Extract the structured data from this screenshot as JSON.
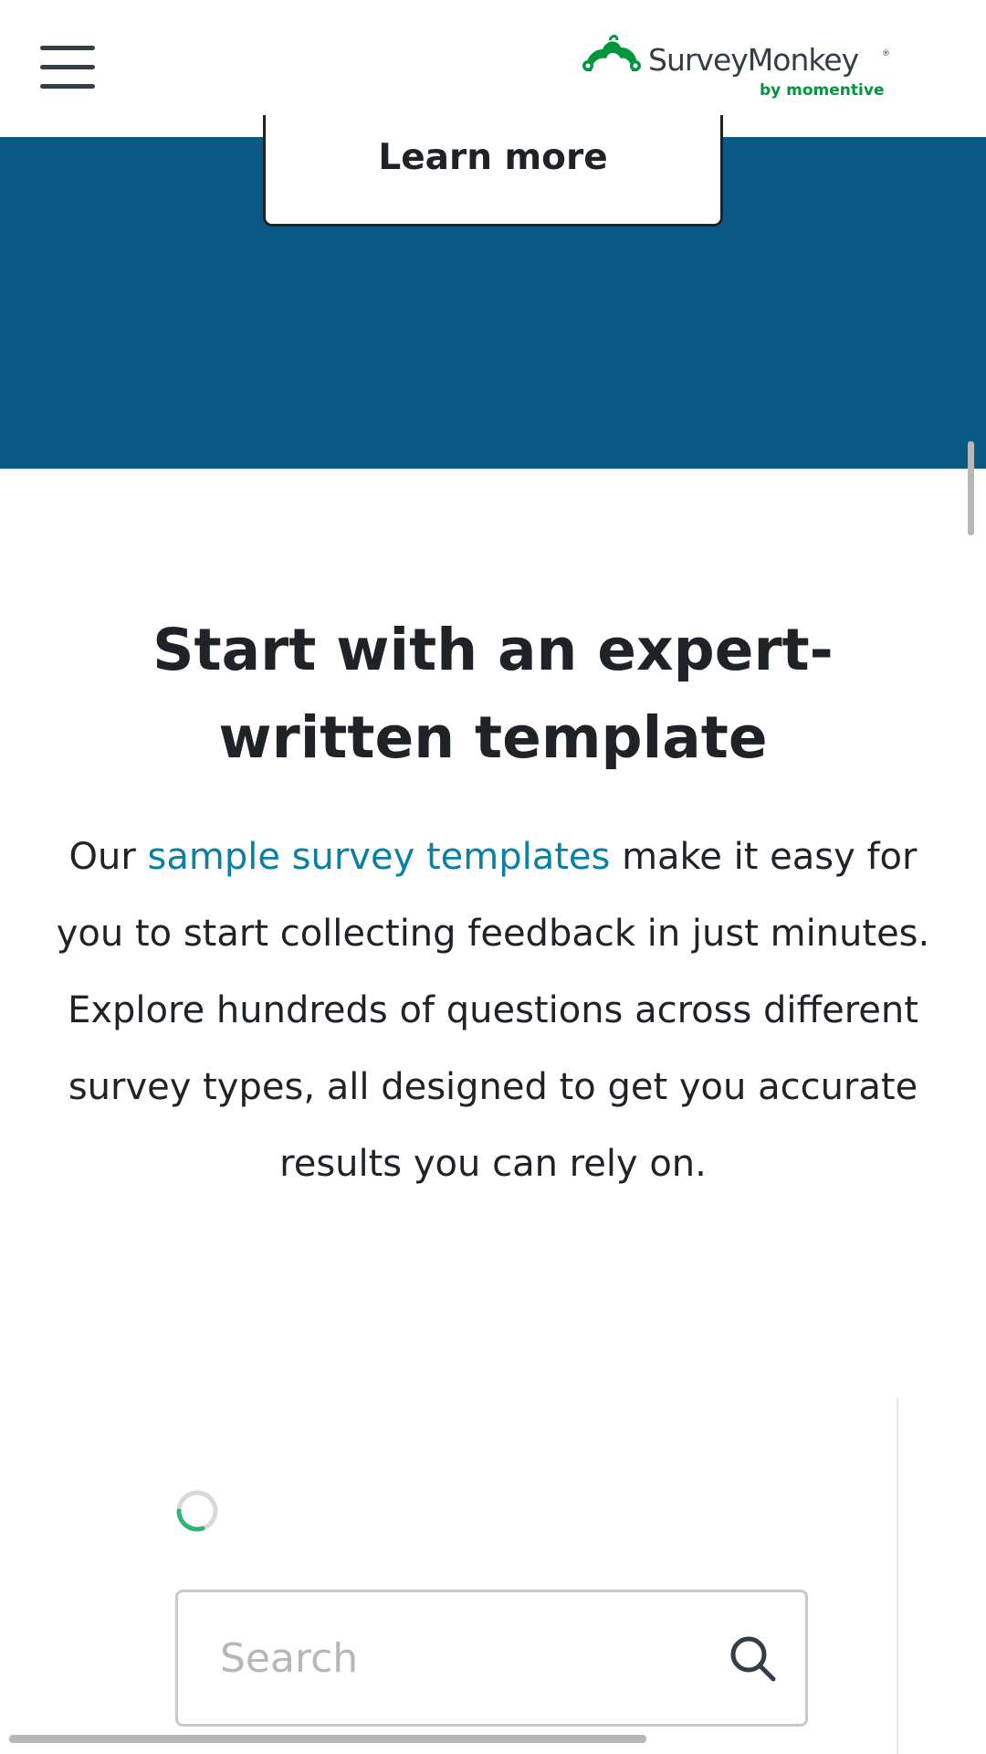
{
  "header": {
    "menu_icon": "hamburger-menu-icon",
    "logo": {
      "wordmark": "SurveyMonkey",
      "registered": "®",
      "tagline": "by momentive",
      "brand_color": "#00963d"
    }
  },
  "hero": {
    "background_color": "#0b5a86",
    "learn_more_label": "Learn more"
  },
  "main": {
    "title": "Start with an expert-written template",
    "description": {
      "prefix": "Our ",
      "link_text": "sample survey templates",
      "suffix": " make it easy for you to start collecting feedback in just minutes. Explore hundreds of questions across different survey types, all designed to get you accurate results you can rely on.",
      "link_color": "#0a7fa6"
    }
  },
  "search": {
    "placeholder": "Search",
    "value": "",
    "icon": "search-icon"
  },
  "loading": {
    "icon": "loading-spinner-icon",
    "accent_color": "#2bb673"
  }
}
